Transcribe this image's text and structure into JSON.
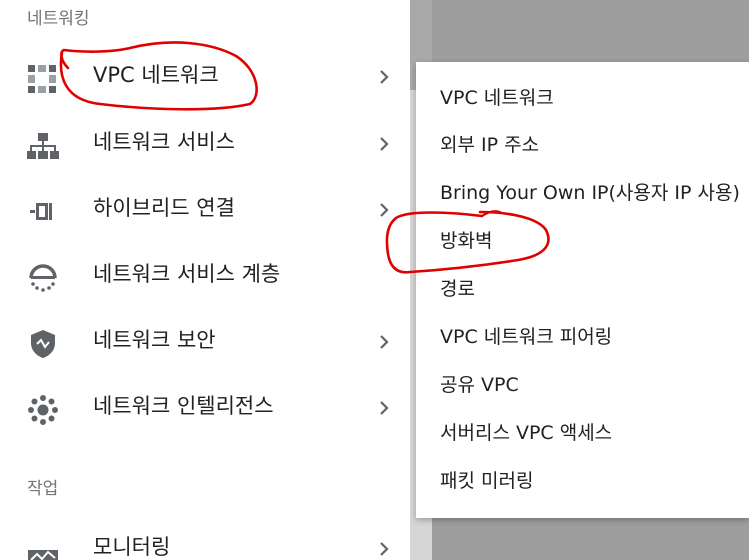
{
  "sidebar": {
    "section_networking": "네트워킹",
    "section_operations": "작업",
    "items": [
      {
        "label": "VPC 네트워크",
        "icon": "vpc-network-icon"
      },
      {
        "label": "네트워크 서비스",
        "icon": "network-services-icon"
      },
      {
        "label": "하이브리드 연결",
        "icon": "hybrid-connectivity-icon"
      },
      {
        "label": "네트워크 서비스 계층",
        "icon": "network-service-tiers-icon"
      },
      {
        "label": "네트워크 보안",
        "icon": "network-security-icon"
      },
      {
        "label": "네트워크 인텔리전스",
        "icon": "network-intelligence-icon"
      },
      {
        "label": "모니터링",
        "icon": "monitoring-icon"
      }
    ]
  },
  "submenu": {
    "items": [
      "VPC 네트워크",
      "외부 IP 주소",
      "Bring Your Own IP(사용자 IP 사용)",
      "방화벽",
      "경로",
      "VPC 네트워크 피어링",
      "공유 VPC",
      "서버리스 VPC 액세스",
      "패킷 미러링"
    ]
  },
  "colors": {
    "annotation": "#e00000",
    "icon_gray": "#5f6368",
    "text": "#202124",
    "section": "#747474"
  }
}
